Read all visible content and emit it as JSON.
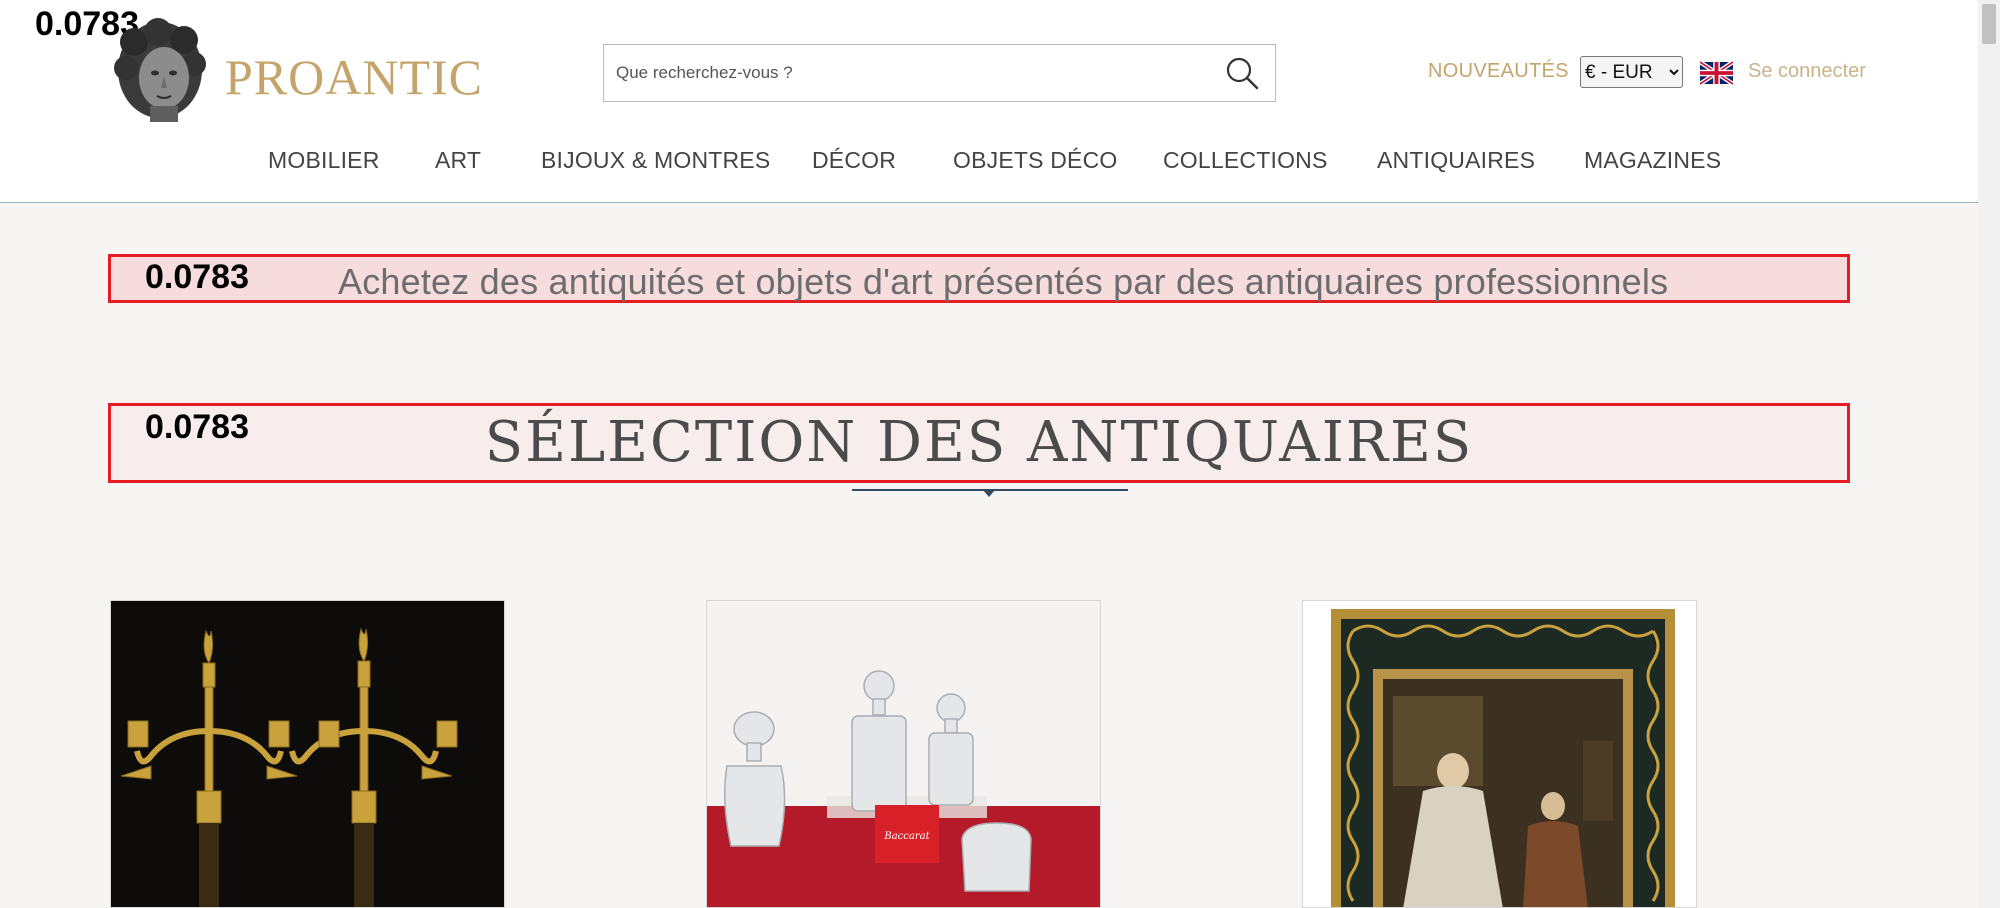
{
  "overlay": {
    "score": "0.0783"
  },
  "header": {
    "logo_text": "PROANTIC",
    "search_placeholder": "Que recherchez-vous ?",
    "nouveautes": "NOUVEAUTÉS",
    "currency_selected": "€ - EUR",
    "login": "Se connecter",
    "flag_icon": "uk-flag-icon",
    "search_icon": "search-icon"
  },
  "nav": {
    "items": [
      {
        "label": "MOBILIER"
      },
      {
        "label": "ART"
      },
      {
        "label": "BIJOUX & MONTRES"
      },
      {
        "label": "DÉCOR"
      },
      {
        "label": "OBJETS DÉCO"
      },
      {
        "label": "COLLECTIONS"
      },
      {
        "label": "ANTIQUAIRES"
      },
      {
        "label": "MAGAZINES"
      }
    ]
  },
  "banner": {
    "text": "Achetez des antiquités et objets d'art présentés par des antiquaires professionnels"
  },
  "section": {
    "title": "SÉLECTION DES ANTIQUAIRES"
  },
  "colors": {
    "accent_gold": "#c4a46a",
    "highlight_red": "#e51c23",
    "underline_navy": "#334a63"
  }
}
